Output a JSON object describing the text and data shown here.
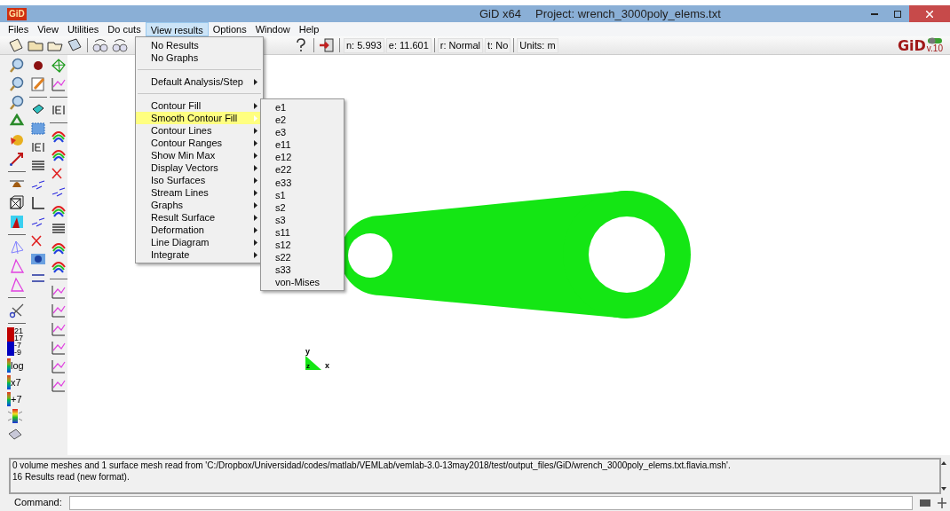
{
  "window": {
    "logo": "GiD",
    "app_title": "GiD x64",
    "project_title": "Project: wrench_3000poly_elems.txt"
  },
  "menu_bar": [
    {
      "label": "Files",
      "selected": false
    },
    {
      "label": "View",
      "selected": false
    },
    {
      "label": "Utilities",
      "selected": false
    },
    {
      "label": "Do cuts",
      "selected": false
    },
    {
      "label": "View results",
      "selected": true
    },
    {
      "label": "Options",
      "selected": false
    },
    {
      "label": "Window",
      "selected": false
    },
    {
      "label": "Help",
      "selected": false
    }
  ],
  "status_fields": [
    "n: 5.993",
    "e: 11.601",
    "r: Normal",
    "t: No",
    "Units: m"
  ],
  "brand": {
    "logo": "GiD",
    "version": "v.10"
  },
  "legend": {
    "top_values": [
      "21",
      "17"
    ],
    "bottom_values": [
      "-7",
      "-9"
    ],
    "scales": [
      "log",
      "x7",
      "+7"
    ]
  },
  "view_results_menu": [
    {
      "kind": "item",
      "label": "No Results",
      "submenu": false,
      "selected": false
    },
    {
      "kind": "item",
      "label": "No Graphs",
      "submenu": false,
      "selected": false
    },
    {
      "kind": "separator"
    },
    {
      "kind": "item",
      "label": "Default Analysis/Step",
      "submenu": true,
      "selected": false
    },
    {
      "kind": "separator"
    },
    {
      "kind": "item",
      "label": "Contour Fill",
      "submenu": true,
      "selected": false
    },
    {
      "kind": "item",
      "label": "Smooth Contour Fill",
      "submenu": true,
      "selected": true
    },
    {
      "kind": "item",
      "label": "Contour Lines",
      "submenu": true,
      "selected": false
    },
    {
      "kind": "item",
      "label": "Contour Ranges",
      "submenu": true,
      "selected": false
    },
    {
      "kind": "item",
      "label": "Show Min Max",
      "submenu": true,
      "selected": false
    },
    {
      "kind": "item",
      "label": "Display Vectors",
      "submenu": true,
      "selected": false
    },
    {
      "kind": "item",
      "label": "Iso Surfaces",
      "submenu": true,
      "selected": false
    },
    {
      "kind": "item",
      "label": "Stream Lines",
      "submenu": true,
      "selected": false
    },
    {
      "kind": "item",
      "label": "Graphs",
      "submenu": true,
      "selected": false
    },
    {
      "kind": "item",
      "label": "Result Surface",
      "submenu": true,
      "selected": false
    },
    {
      "kind": "item",
      "label": "Deformation",
      "submenu": true,
      "selected": false
    },
    {
      "kind": "item",
      "label": "Line Diagram",
      "submenu": true,
      "selected": false
    },
    {
      "kind": "item",
      "label": "Integrate",
      "submenu": true,
      "selected": false
    }
  ],
  "submenu": [
    "e1",
    "e2",
    "e3",
    "e11",
    "e12",
    "e22",
    "e33",
    "s1",
    "s2",
    "s3",
    "s11",
    "s12",
    "s22",
    "s33",
    "von-Mises"
  ],
  "axes": {
    "y": "y",
    "x": "x",
    "z": "z"
  },
  "log_lines": [
    "0 volume meshes and 1 surface mesh read from 'C:/Dropbox/Universidad/codes/matlab/VEMLab/vemlab-3.0-13may2018/test/output_files/GiD/wrench_3000poly_elems.txt.flavia.msh'.",
    "16 Results read (new format)."
  ],
  "command": {
    "label": "Command:"
  }
}
